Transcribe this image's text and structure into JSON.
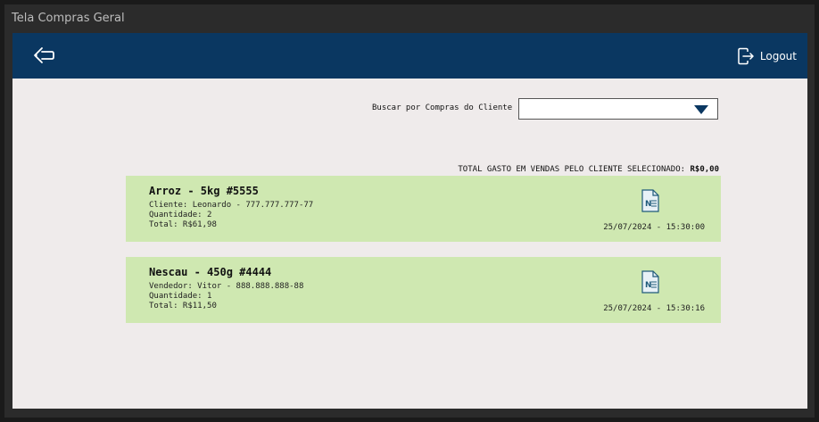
{
  "window": {
    "title": "Tela Compras Geral"
  },
  "header": {
    "back_icon": "back-arrow-icon",
    "logout_icon": "logout-icon",
    "logout_label": "Logout"
  },
  "search": {
    "label": "Buscar por Compras do Cliente",
    "selected": ""
  },
  "total": {
    "label": "TOTAL GASTO EM VENDAS PELO CLIENTE SELECIONADO:",
    "value": "R$0,00"
  },
  "purchases": [
    {
      "title": "Arroz - 5kg #5555",
      "person": "Cliente: Leonardo - 777.777.777-77",
      "quantity": "Quantidade: 2",
      "total": "Total: R$61,98",
      "datetime": "25/07/2024 - 15:30:00",
      "icon": "invoice-document-icon"
    },
    {
      "title": "Nescau - 450g #4444",
      "person": "Vendedor: Vitor - 888.888.888-88",
      "quantity": "Quantidade: 1",
      "total": "Total: R$11,50",
      "datetime": "25/07/2024 - 15:30:16",
      "icon": "invoice-document-icon"
    }
  ],
  "colors": {
    "header_bg": "#0a3761",
    "content_bg": "#efebeb",
    "card_bg": "#cfe8b1",
    "dropdown_arrow": "#0a3761"
  }
}
